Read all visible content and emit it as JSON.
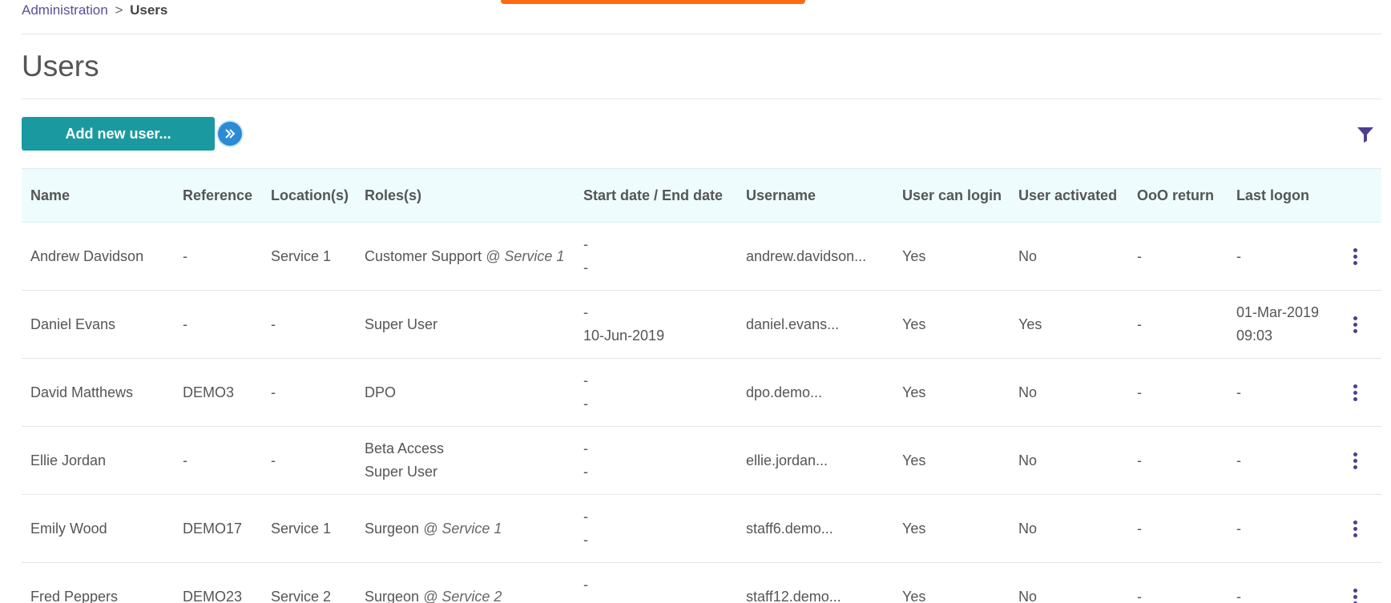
{
  "breadcrumb": {
    "parent": "Administration",
    "separator": ">",
    "current": "Users"
  },
  "page": {
    "title": "Users",
    "add_button_label": "Add new user...",
    "banner_color": "#ff6a13",
    "accent_color": "#1a9aa0"
  },
  "icons": {
    "expand": "double-chevron-right-icon",
    "filter": "funnel-filter-icon",
    "row_menu": "vertical-ellipsis-icon"
  },
  "table": {
    "headers": {
      "name": "Name",
      "reference": "Reference",
      "locations": "Location(s)",
      "roles": "Roles(s)",
      "dates": "Start date / End date",
      "username": "Username",
      "can_login": "User can login",
      "activated": "User activated",
      "ooo_return": "OoO return",
      "last_logon": "Last logon"
    },
    "rows": [
      {
        "name": "Andrew Davidson",
        "reference": "-",
        "locations": "Service 1",
        "roles": [
          {
            "role": "Customer Support",
            "at": "@ Service 1"
          }
        ],
        "start": "-",
        "end": "-",
        "username": "andrew.davidson...",
        "can_login": "Yes",
        "activated": "No",
        "ooo_return": "-",
        "last_logon": [
          "-"
        ]
      },
      {
        "name": "Daniel Evans",
        "reference": "-",
        "locations": "-",
        "roles": [
          {
            "role": "Super User",
            "at": ""
          }
        ],
        "start": "-",
        "end": "10-Jun-2019",
        "username": "daniel.evans...",
        "can_login": "Yes",
        "activated": "Yes",
        "ooo_return": "-",
        "last_logon": [
          "01-Mar-2019",
          "09:03"
        ]
      },
      {
        "name": "David Matthews",
        "reference": "DEMO3",
        "locations": "-",
        "roles": [
          {
            "role": "DPO",
            "at": ""
          }
        ],
        "start": "-",
        "end": "-",
        "username": "dpo.demo...",
        "can_login": "Yes",
        "activated": "No",
        "ooo_return": "-",
        "last_logon": [
          "-"
        ]
      },
      {
        "name": "Ellie Jordan",
        "reference": "-",
        "locations": "-",
        "roles": [
          {
            "role": "Beta Access",
            "at": ""
          },
          {
            "role": "Super User",
            "at": ""
          }
        ],
        "start": "-",
        "end": "-",
        "username": "ellie.jordan...",
        "can_login": "Yes",
        "activated": "No",
        "ooo_return": "-",
        "last_logon": [
          "-"
        ]
      },
      {
        "name": "Emily Wood",
        "reference": "DEMO17",
        "locations": "Service 1",
        "roles": [
          {
            "role": "Surgeon",
            "at": "@ Service 1"
          }
        ],
        "start": "-",
        "end": "-",
        "username": "staff6.demo...",
        "can_login": "Yes",
        "activated": "No",
        "ooo_return": "-",
        "last_logon": [
          "-"
        ]
      },
      {
        "name": "Fred Peppers",
        "reference": "DEMO23",
        "locations": "Service 2",
        "roles": [
          {
            "role": "Surgeon",
            "at": "@ Service 2"
          }
        ],
        "start": "-",
        "end": "",
        "username": "staff12.demo...",
        "can_login": "Yes",
        "activated": "No",
        "ooo_return": "-",
        "last_logon": [
          "-"
        ]
      }
    ]
  }
}
